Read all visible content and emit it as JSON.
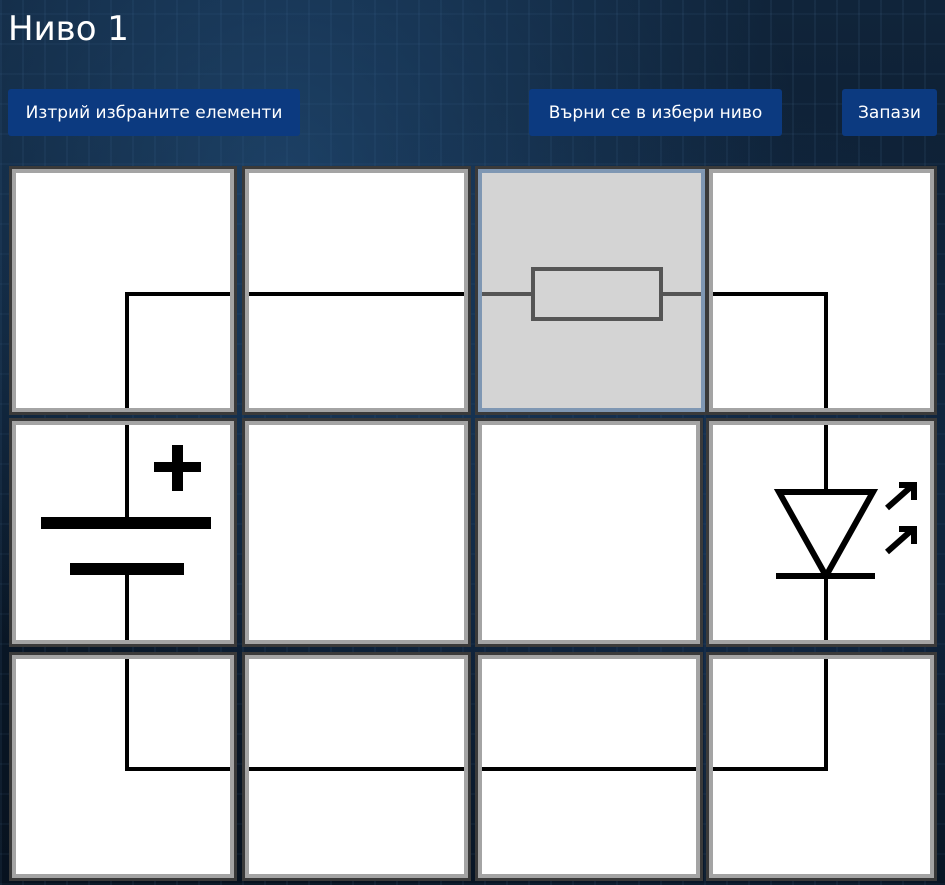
{
  "level": {
    "title": "Ниво 1"
  },
  "toolbar": {
    "delete_label": "Изтрий избраните елементи",
    "back_label": "Върни се в избери ниво",
    "save_label": "Запази"
  },
  "board": {
    "rows": 3,
    "cols": 4,
    "selected_cell": "r0c2",
    "cells": [
      [
        "corner-wire-right-down",
        "horizontal-wire",
        "resistor",
        "corner-wire-left-down"
      ],
      [
        "battery",
        "empty",
        "empty",
        "led"
      ],
      [
        "corner-wire-up-right",
        "horizontal-wire",
        "horizontal-wire",
        "corner-wire-left-up"
      ]
    ]
  },
  "colors": {
    "button_bg": "#0c3a80",
    "cell_bg": "#ffffff",
    "selected_bg": "#d4d4d4",
    "wire": "#000000",
    "resistor_stroke": "#555555"
  }
}
